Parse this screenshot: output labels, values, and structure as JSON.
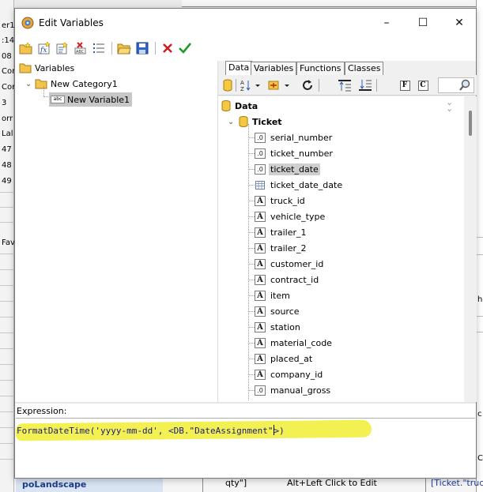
{
  "background": {
    "left_fragments": [
      "er1",
      ":14",
      "08",
      "Cor",
      "Cor",
      "3",
      "orr",
      "Lal",
      "47",
      "48",
      "49",
      "Fav"
    ],
    "bottom_left_title": "poLandscape",
    "bottom_fragment_1": "qty\"]",
    "bottom_fragment_2": "Alt+Left Click to Edit",
    "bottom_fragment_3": "[Ticket.\"truc",
    "right_fragments": [
      "hi",
      "c",
      "Cl"
    ]
  },
  "dialog": {
    "title": "Edit Variables",
    "icons": {
      "app": "variables-app-icon",
      "minimize": "–",
      "maximize": "☐",
      "close": "✕"
    },
    "toolbar": [
      "new-category-icon",
      "new-function-icon",
      "edit-icon",
      "delete-icon",
      "list-icon",
      "open-icon",
      "save-icon",
      "cancel-icon",
      "ok-icon"
    ]
  },
  "tree": {
    "root": "Variables",
    "category": "New Category1",
    "variable": "New Variable1"
  },
  "panel": {
    "tabs": [
      "Data",
      "Variables",
      "Functions",
      "Classes"
    ],
    "active_tab": "Data",
    "format_buttons": [
      "F",
      "C"
    ],
    "data_root": "Data",
    "table": "Ticket",
    "fields": [
      {
        "name": "serial_number",
        "type": ".0"
      },
      {
        "name": "ticket_number",
        "type": ".0"
      },
      {
        "name": "ticket_date",
        "type": ".0"
      },
      {
        "name": "ticket_date_date",
        "type": "grid"
      },
      {
        "name": "truck_id",
        "type": "A"
      },
      {
        "name": "vehicle_type",
        "type": "A"
      },
      {
        "name": "trailer_1",
        "type": "A"
      },
      {
        "name": "trailer_2",
        "type": "A"
      },
      {
        "name": "customer_id",
        "type": "A"
      },
      {
        "name": "contract_id",
        "type": "A"
      },
      {
        "name": "item",
        "type": "A"
      },
      {
        "name": "source",
        "type": "A"
      },
      {
        "name": "station",
        "type": "A"
      },
      {
        "name": "material_code",
        "type": "A"
      },
      {
        "name": "placed_at",
        "type": "A"
      },
      {
        "name": "company_id",
        "type": "A"
      },
      {
        "name": "manual_gross",
        "type": ".0"
      }
    ],
    "selected_field": "ticket_date"
  },
  "expression": {
    "label": "Expression:",
    "before_caret": "FormatDateTime('yyyy-mm-dd', <DB.\"DateAssignment\"",
    "after_caret": ">)",
    "highlight_color": "#f3f051"
  }
}
